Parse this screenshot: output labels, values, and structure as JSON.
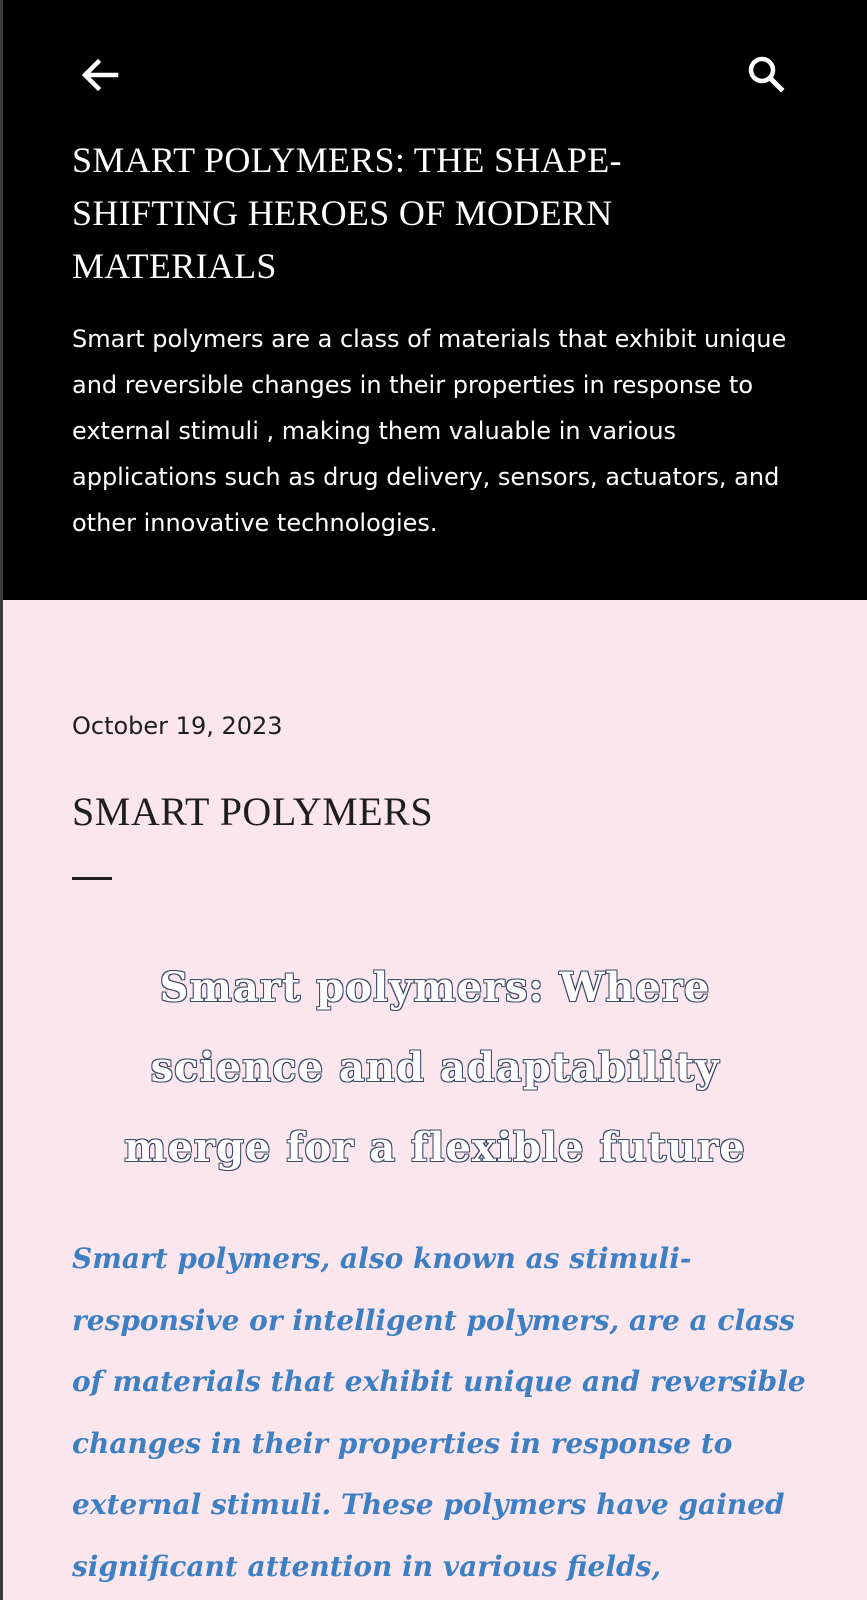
{
  "header": {
    "back_icon": "arrow-left-icon",
    "search_icon": "search-icon",
    "title": "SMART POLYMERS: THE SHAPE-SHIFTING HEROES OF MODERN MATERIALS",
    "description": "Smart polymers are a class of materials that exhibit unique and reversible changes in their properties in response to external stimuli , making them valuable in various applications such as drug delivery, sensors, actuators, and other innovative technologies."
  },
  "post": {
    "date": "October 19, 2023",
    "title": "SMART POLYMERS",
    "subtitle": "Smart polymers: Where science and adaptability merge for a flexible future",
    "intro": "Smart polymers, also known as stimuli-responsive or intelligent polymers, are a class of materials that exhibit unique and reversible changes in their properties in response to external stimuli. These polymers have gained significant attention in various fields, including biomedicine,"
  },
  "colors": {
    "header_bg": "#000000",
    "page_bg": "#fce6ee",
    "accent_blue": "#3d7fc3",
    "text_dark": "#1e1e1e"
  }
}
